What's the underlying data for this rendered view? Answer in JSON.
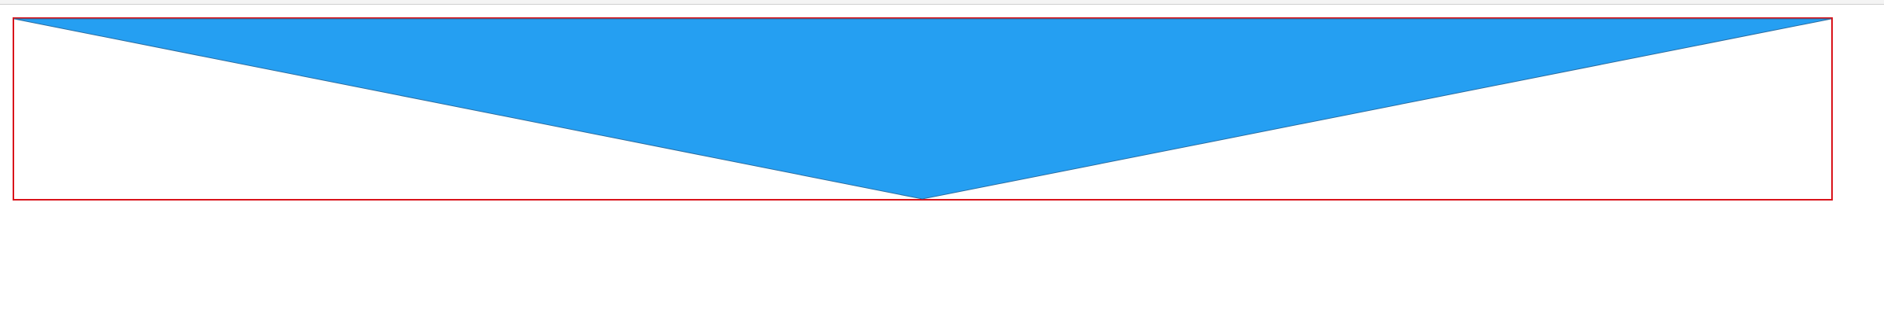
{
  "colors": {
    "background": "#ffffff",
    "frame_border": "#d9141b",
    "triangle_fill": "#259ff2",
    "top_rule": "#cfcfcf"
  },
  "shape": {
    "type": "inverted-triangle"
  }
}
